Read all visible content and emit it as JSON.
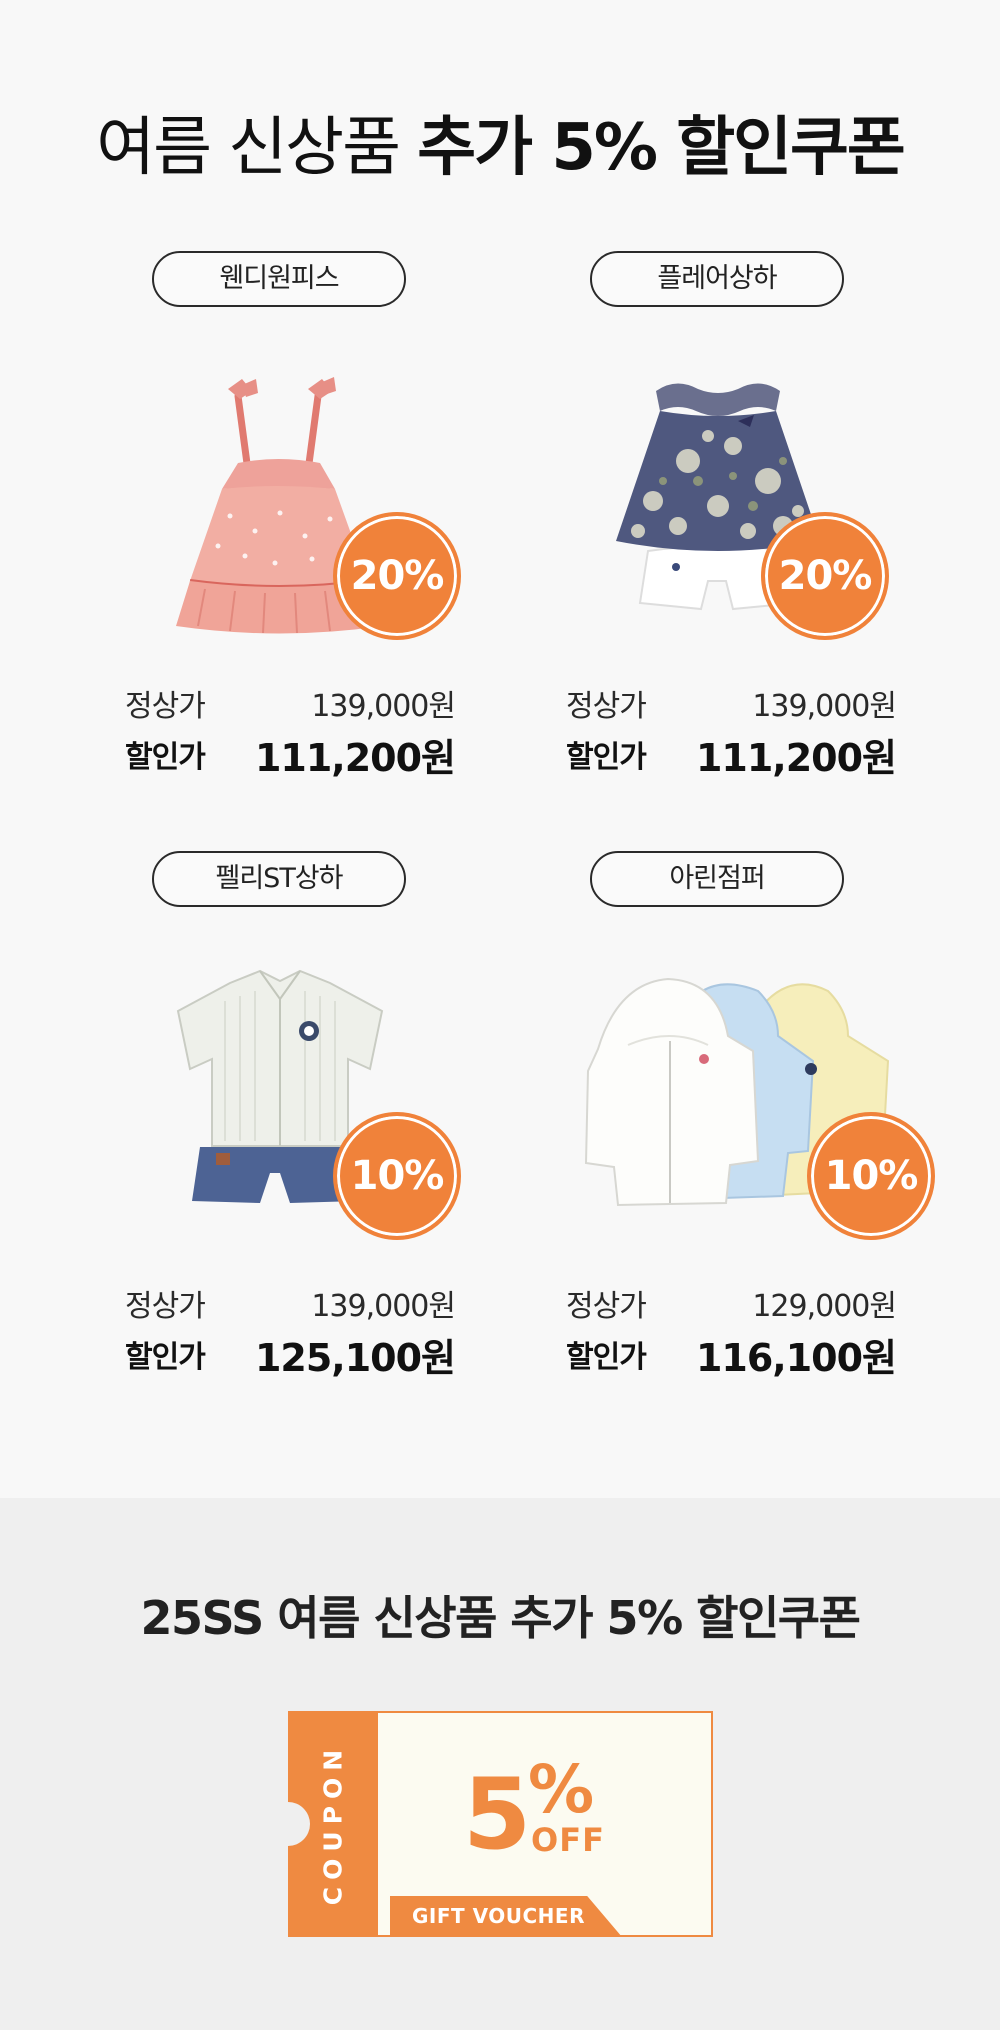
{
  "headline": {
    "regular": "여름 신상품 ",
    "bold": "추가 5% 할인쿠폰"
  },
  "products": [
    {
      "name": "웬디원피스",
      "discount": "20%",
      "regular_label": "정상가",
      "regular_price": "139,000원",
      "sale_label": "할인가",
      "sale_price": "111,200원",
      "image_icon": "pink-dress-image"
    },
    {
      "name": "플레어상하",
      "discount": "20%",
      "regular_label": "정상가",
      "regular_price": "139,000원",
      "sale_label": "할인가",
      "sale_price": "111,200원",
      "image_icon": "floral-top-shorts-image"
    },
    {
      "name": "펠리ST상하",
      "discount": "10%",
      "regular_label": "정상가",
      "regular_price": "139,000원",
      "sale_label": "할인가",
      "sale_price": "125,100원",
      "image_icon": "shirt-shorts-image"
    },
    {
      "name": "아린점퍼",
      "discount": "10%",
      "regular_label": "정상가",
      "regular_price": "129,000원",
      "sale_label": "할인가",
      "sale_price": "116,100원",
      "image_icon": "jackets-image"
    }
  ],
  "coupon_section": {
    "title_regular": "25SS 여름 신상품 ",
    "title_bold": "추가 5% 할인쿠폰",
    "vertical_label": "COUPON",
    "amount": "5",
    "percent": "%",
    "off": "OFF",
    "ribbon": "GIFT VOUCHER"
  },
  "colors": {
    "accent": "#ef8a41",
    "badge": "#f0823a",
    "top_background": "#f8f8f8",
    "bottom_background": "#efefef",
    "coupon_background": "#fcfbf1"
  }
}
